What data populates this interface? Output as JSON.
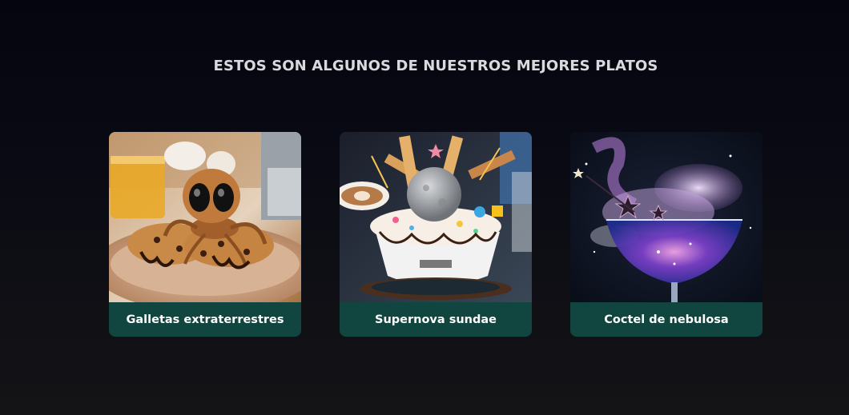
{
  "section": {
    "title": "ESTOS SON ALGUNOS DE NUESTROS MEJORES PLATOS"
  },
  "dishes": [
    {
      "name": "Galletas extraterrestres",
      "image": "alien-cookies-photo"
    },
    {
      "name": "Supernova sundae",
      "image": "supernova-sundae-photo"
    },
    {
      "name": "Coctel de nebulosa",
      "image": "nebula-cocktail-photo"
    }
  ],
  "colors": {
    "background": "#0a0a14",
    "card_caption_bg": "#11453f",
    "title_text": "#d9d9de",
    "caption_text": "#ffffff"
  }
}
